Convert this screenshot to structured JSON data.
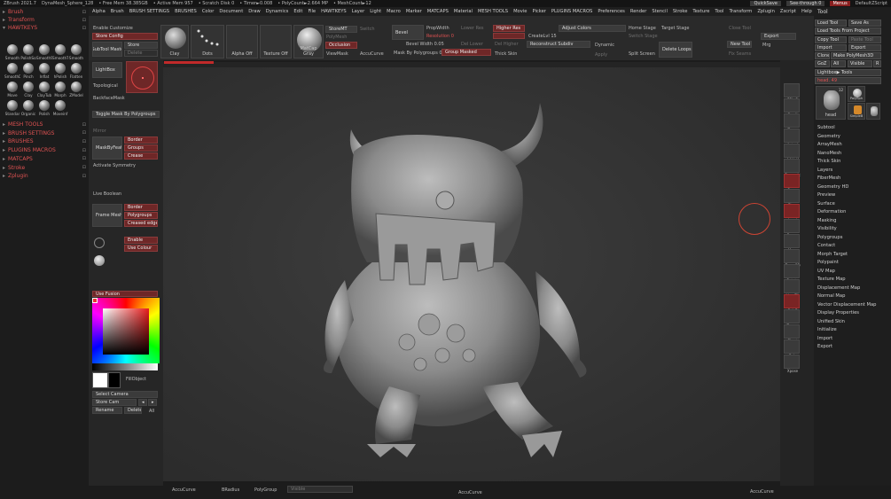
{
  "titlebar": {
    "app": "ZBrush 2021.7",
    "doc": "DynaMesh_Sphere_128",
    "mem": "• Free Mem 38.385GB",
    "active": "• Active Mem 957",
    "scratch": "• Scratch Disk 0",
    "timer": "• Timer►0.008",
    "polycount": "• PolyCount►2.664 MP",
    "meshcount": "• MeshCount►12",
    "quicksave": "QuickSave",
    "seethrough": "See-through  0",
    "menus": "Menus",
    "script": "DefaultZScript"
  },
  "menubar": [
    "Alpha",
    "Brush",
    "BRUSH SETTINGS",
    "BRUSHES",
    "Color",
    "Document",
    "Draw",
    "Dynamics",
    "Edit",
    "File",
    "HAWTKEYS",
    "Layer",
    "Light",
    "Macro",
    "Marker",
    "MATCAPS",
    "Material",
    "MESH TOOLS",
    "Movie",
    "Picker",
    "PLUGINS MACROS",
    "Preferences",
    "Render",
    "Stencil",
    "Stroke",
    "Texture",
    "Tool",
    "Transform",
    "Zplugin",
    "Zscript",
    "Help"
  ],
  "leftpalette": {
    "items": [
      "Brush",
      "Transform",
      "HAWTKEYS"
    ],
    "brushes": [
      "Smooth",
      "PolishSo",
      "SmoothS",
      "SmoothT",
      "Smooth",
      "SmoothDams",
      "Pinch",
      "Inflat",
      "hPolish",
      "Flatten",
      "Move",
      "Clay",
      "ClayTub",
      "Morph",
      "ZModel",
      "Standar",
      "Organic",
      "Polish",
      "Moveinf"
    ],
    "menus": [
      "MESH TOOLS",
      "BRUSH SETTINGS",
      "BRUSHES",
      "PLUGINS MACROS",
      "MATCAPS",
      "Stroke",
      "Zplugin"
    ]
  },
  "toptray": {
    "enable_customize": "Enable Customize",
    "store_config": "Store Config",
    "subtool_master": "SubTool Master",
    "store": "Store",
    "delete": "Delete",
    "clay": "Clay",
    "dots": "Dots",
    "alpha_off": "Alpha Off",
    "texture_off": "Texture Off",
    "matcap_gray": "MatCap Gray",
    "storemt": "StoreMT",
    "switch": "Switch",
    "polish_mesh": "PolyMesh",
    "occlusion": "Occlusion",
    "viewmask": "ViewMask",
    "accucurve": "AccuCurve",
    "bevel": "Bevel",
    "propwidth": "PropWidth",
    "resolution": "Resolution 0",
    "bevel_width": "Bevel Width 0.05",
    "mask_by_polygroups": "Mask By Polygroups 0",
    "group_masked": "Group Masked",
    "lower_res": "Lower Res",
    "higher_res": "Higher Res",
    "createlvl": "CreateLvl 15",
    "reconstruct": "Reconstruct Subdiv",
    "del_lower": "Del Lower",
    "del_higher": "Del Higher",
    "thick_skin": "Thick Skin",
    "adjust_colors": "Adjust Colors",
    "dynamic": "Dynamic",
    "home_stage": "Home Stage",
    "switch_stage": "Switch Stage",
    "target_stage": "Target Stage",
    "split_screen": "Split Screen",
    "delete_loops": "Delete Loops",
    "close_tool": "Close Tool",
    "new_tool": "New Tool",
    "mrg": "Mrg",
    "fix_seams": "Fix Seams",
    "export": "Export",
    "apply": "Apply"
  },
  "leftshelf": {
    "lightbox": "LightBox",
    "topological": "Topological",
    "backface": "BackfaceMask",
    "toggle_mask": "Toggle Mask By Polygroups",
    "mirror": "Mirror",
    "mask_by_feature": "MaskByFeature",
    "border": "Border",
    "groups": "Groups",
    "crease": "Crease",
    "activate_symmetry": "Activate Symmetry",
    "live_boolean": "Live Boolean",
    "frame_mesh": "Frame Mesh",
    "polygroups": "Polygroups",
    "creased_edges": "Creased edges",
    "enable": "Enable",
    "use_colour": "Use Colour",
    "use_fusion": "Use Fusion",
    "fillobject": "FillObject",
    "select_camera": "Select Camera",
    "store_cam": "Store Cam",
    "rename": "Rename",
    "delete_cam": "Delete",
    "all": "All"
  },
  "rightshelf": [
    "SPix 3",
    "Scroll",
    "Zoom",
    "Actual",
    "AAHalf",
    "Dynamic",
    "Persp",
    "Floor",
    "Local",
    "Frame",
    "Move",
    "Zoom3D",
    "Rotate",
    "Line Fill",
    "PolyF",
    "Transp",
    "Ghost",
    "Solo",
    "Xpose"
  ],
  "tray": {
    "header": "Tool",
    "load_tool": "Load Tool",
    "save_as": "Save As",
    "load_from_project": "Load Tools From Project",
    "copy_tool": "Copy Tool",
    "paste_tool": "Paste Tool",
    "import": "Import",
    "export": "Export",
    "clone": "Clone",
    "make_polymesh": "Make PolyMesh3D",
    "goz": "GoZ",
    "all": "All",
    "visible": "Visible",
    "r": "R",
    "lightbox_tools": "Lightbox▶ Tools",
    "head_label": "head. 49",
    "thumb_head": "head",
    "thumb_polysphere": "PolySph",
    "thumb_simple": "SimpleB",
    "thumb_count": "12",
    "items": [
      "Subtool",
      "Geometry",
      "ArrayMesh",
      "NanoMesh",
      "Thick Skin",
      "Layers",
      "FiberMesh",
      "Geometry HD",
      "Preview",
      "Surface",
      "Deformation",
      "Masking",
      "Visibility",
      "Polygroups",
      "Contact",
      "Morph Target",
      "Polypaint",
      "UV Map",
      "Texture Map",
      "Displacement Map",
      "Normal Map",
      "Vector Displacement Map",
      "Display Properties",
      "Unified Skin",
      "Initialize",
      "Import",
      "Export"
    ]
  },
  "bottombar": {
    "accucurve": "AccuCurve",
    "bradius": "BRadius",
    "polygroup": "PolyGroup",
    "visible": "Visible",
    "accucurve2": "AccuCurve",
    "accucurve3": "AccuCurve"
  },
  "colors": {
    "accent": "#c12a2a",
    "bg": "#2e2e2e",
    "menu": "#1f1f1f"
  }
}
